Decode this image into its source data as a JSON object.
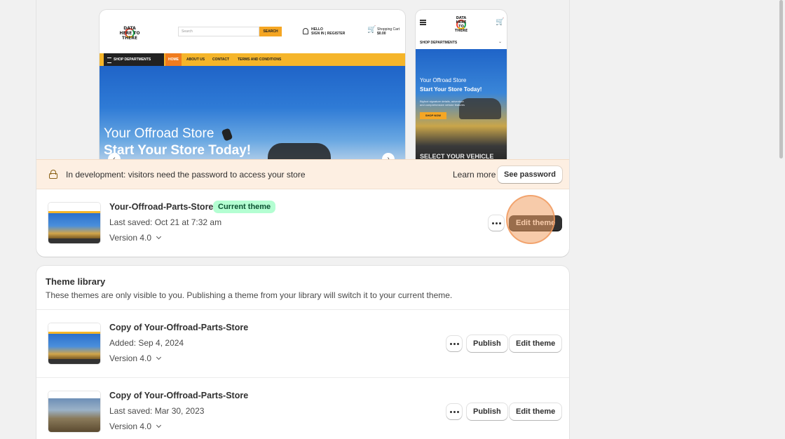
{
  "preview": {
    "desktop": {
      "logo_text": "DATA HERE TO THERE",
      "search_placeholder": "Search",
      "search_button": "SEARCH",
      "user_line1": "HELLO",
      "user_line2": "SIGN IN | REGISTER",
      "cart_line1": "Shopping Cart",
      "cart_line2": "$0.00",
      "shop_departments": "SHOP DEPARTMENTS",
      "nav": [
        "HOME",
        "ABOUT US",
        "CONTACT",
        "TERMS AND CONDITIONS"
      ],
      "hero_line1": "Your Offroad Store",
      "hero_line2": "Start Your Store Today!",
      "arrow_left": "‹",
      "arrow_right": "›"
    },
    "mobile": {
      "logo_text": "DATA HERE TO THERE",
      "shop_departments": "SHOP DEPARTMENTS",
      "chevron": "⌄",
      "hero_line1": "Your Offroad Store",
      "hero_line2": "Start Your Store Today!",
      "hero_desc": "Bigfoot signature details, adventure and comprehensive vehicle features",
      "shop_now": "SHOP NOW",
      "select_vehicle": "SELECT YOUR VEHICLE"
    }
  },
  "banner": {
    "message": "In development: visitors need the password to access your store",
    "learn_more": "Learn more",
    "see_password": "See password"
  },
  "current_theme": {
    "name": "Your-Offroad-Parts-Store",
    "badge": "Current theme",
    "saved": "Last saved: Oct 21 at 7:32 am",
    "version": "Version 4.0",
    "edit_label": "Edit theme"
  },
  "library": {
    "title": "Theme library",
    "description": "These themes are only visible to you. Publishing a theme from your library will switch it to your current theme.",
    "themes": [
      {
        "name": "Copy of Your-Offroad-Parts-Store",
        "saved": "Added: Sep 4, 2024",
        "version": "Version 4.0",
        "publish_label": "Publish",
        "edit_label": "Edit theme"
      },
      {
        "name": "Copy of Your-Offroad-Parts-Store",
        "saved": "Last saved: Mar 30, 2023",
        "version": "Version 4.0",
        "publish_label": "Publish",
        "edit_label": "Edit theme"
      }
    ]
  },
  "colors": {
    "banner_bg": "#fdefe2",
    "badge_bg": "#b4fed2",
    "badge_text": "#0c5132",
    "primary_button": "#303030",
    "highlight": "#f0a064"
  }
}
